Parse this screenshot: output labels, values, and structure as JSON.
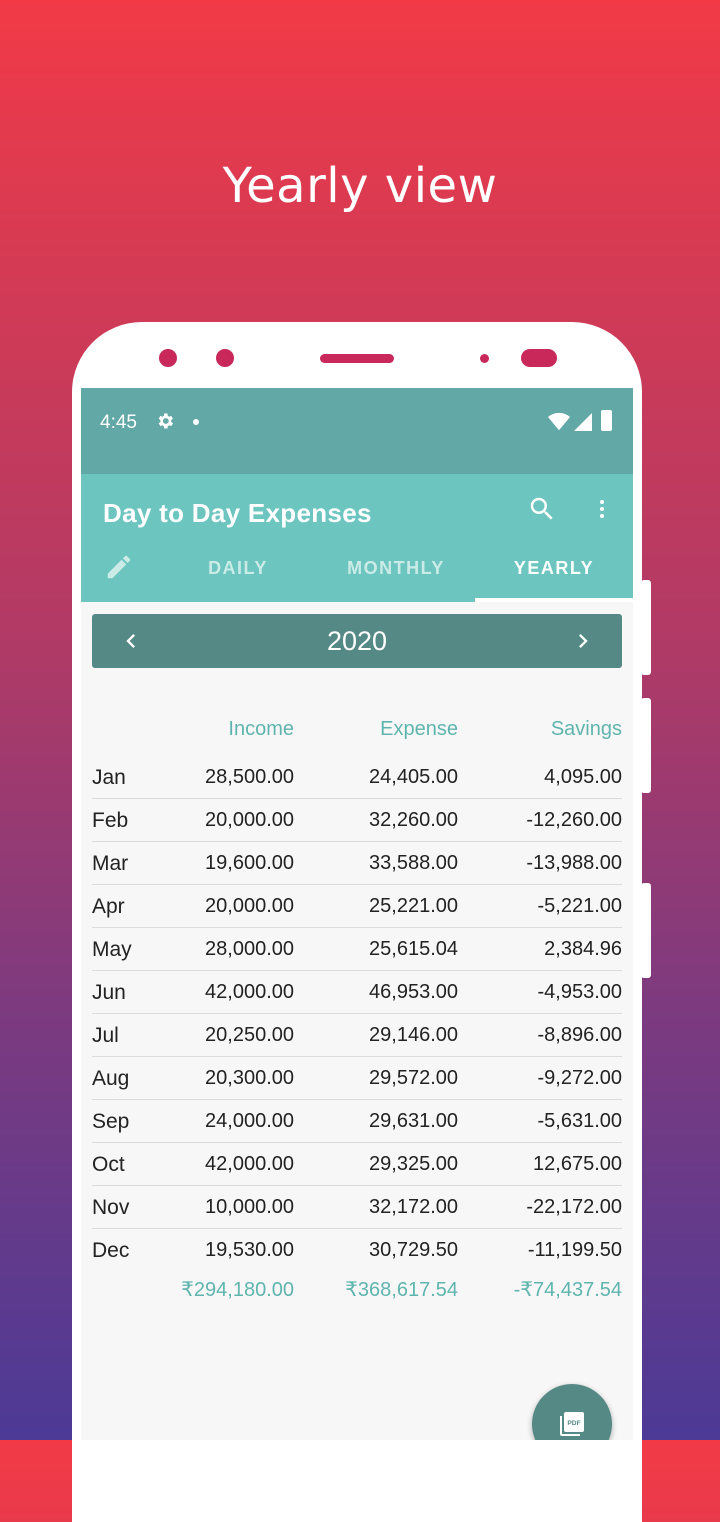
{
  "promo": {
    "title": "Yearly view"
  },
  "status": {
    "time": "4:45"
  },
  "app": {
    "title": "Day to Day Expenses",
    "tabs": [
      "DAILY",
      "MONTHLY",
      "YEARLY"
    ],
    "active_tab": "YEARLY"
  },
  "year_nav": {
    "year": "2020"
  },
  "table": {
    "headers": {
      "income": "Income",
      "expense": "Expense",
      "savings": "Savings"
    },
    "rows": [
      {
        "month": "Jan",
        "income": "28,500.00",
        "expense": "24,405.00",
        "savings": "4,095.00"
      },
      {
        "month": "Feb",
        "income": "20,000.00",
        "expense": "32,260.00",
        "savings": "-12,260.00"
      },
      {
        "month": "Mar",
        "income": "19,600.00",
        "expense": "33,588.00",
        "savings": "-13,988.00"
      },
      {
        "month": "Apr",
        "income": "20,000.00",
        "expense": "25,221.00",
        "savings": "-5,221.00"
      },
      {
        "month": "May",
        "income": "28,000.00",
        "expense": "25,615.04",
        "savings": "2,384.96"
      },
      {
        "month": "Jun",
        "income": "42,000.00",
        "expense": "46,953.00",
        "savings": "-4,953.00"
      },
      {
        "month": "Jul",
        "income": "20,250.00",
        "expense": "29,146.00",
        "savings": "-8,896.00"
      },
      {
        "month": "Aug",
        "income": "20,300.00",
        "expense": "29,572.00",
        "savings": "-9,272.00"
      },
      {
        "month": "Sep",
        "income": "24,000.00",
        "expense": "29,631.00",
        "savings": "-5,631.00"
      },
      {
        "month": "Oct",
        "income": "42,000.00",
        "expense": "29,325.00",
        "savings": "12,675.00"
      },
      {
        "month": "Nov",
        "income": "10,000.00",
        "expense": "32,172.00",
        "savings": "-22,172.00"
      },
      {
        "month": "Dec",
        "income": "19,530.00",
        "expense": "30,729.50",
        "savings": "-11,199.50"
      }
    ],
    "totals": {
      "income": "₹294,180.00",
      "expense": "₹368,617.54",
      "savings": "-₹74,437.54"
    }
  },
  "fab": {
    "label": "PDF",
    "icon": "pdf-icon"
  },
  "colors": {
    "status_bar": "#62a8a6",
    "toolbar": "#6cc5bf",
    "year_bar": "#558985",
    "accent_text": "#5fb5ae"
  }
}
